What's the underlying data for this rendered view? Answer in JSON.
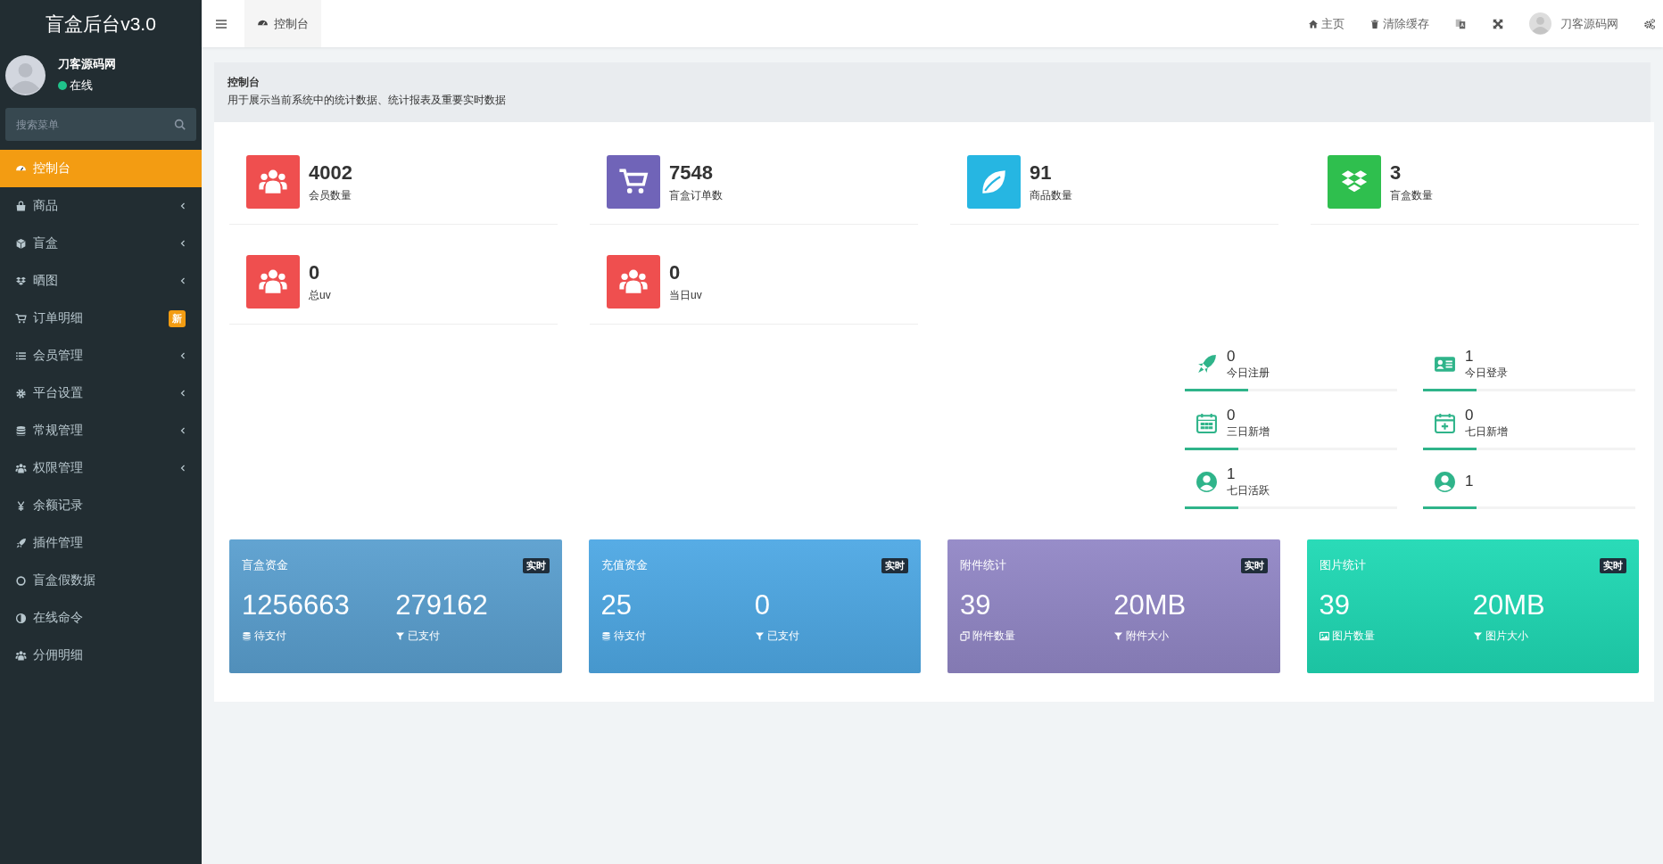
{
  "sidebar": {
    "logo": "盲盒后台v3.0",
    "user": {
      "name": "刀客源码网",
      "status": "在线",
      "online": true
    },
    "search": {
      "placeholder": "搜索菜单"
    },
    "items": [
      {
        "label": "控制台",
        "selected": true,
        "submenu": false
      },
      {
        "label": "商品",
        "selected": false,
        "submenu": true
      },
      {
        "label": "盲盒",
        "selected": false,
        "submenu": true
      },
      {
        "label": "晒图",
        "selected": false,
        "submenu": true
      },
      {
        "label": "订单明细",
        "selected": false,
        "submenu": false,
        "badge": "新"
      },
      {
        "label": "会员管理",
        "selected": false,
        "submenu": true
      },
      {
        "label": "平台设置",
        "selected": false,
        "submenu": true
      },
      {
        "label": "常规管理",
        "selected": false,
        "submenu": true
      },
      {
        "label": "权限管理",
        "selected": false,
        "submenu": true
      },
      {
        "label": "余额记录",
        "selected": false,
        "submenu": false
      },
      {
        "label": "插件管理",
        "selected": false,
        "submenu": false
      },
      {
        "label": "盲盒假数据",
        "selected": false,
        "submenu": false
      },
      {
        "label": "在线命令",
        "selected": false,
        "submenu": false
      },
      {
        "label": "分佣明细",
        "selected": false,
        "submenu": false
      }
    ]
  },
  "topbar": {
    "tabs": [
      {
        "label": "控制台"
      }
    ],
    "links": [
      {
        "label": "主页"
      },
      {
        "label": "清除缓存"
      }
    ],
    "user": "刀客源码网"
  },
  "page_header": {
    "title": "控制台",
    "description": "用于展示当前系统中的统计数据、统计报表及重要实时数据"
  },
  "stats": [
    {
      "value": "4002",
      "label": "会员数量",
      "color": "#ef4f4f"
    },
    {
      "value": "7548",
      "label": "盲盒订单数",
      "color": "#7064b8"
    },
    {
      "value": "91",
      "label": "商品数量",
      "color": "#26b6e2"
    },
    {
      "value": "3",
      "label": "盲盒数量",
      "color": "#2fbf4e"
    },
    {
      "value": "0",
      "label": "总uv",
      "color": "#ef4f4f"
    },
    {
      "value": "0",
      "label": "当日uv",
      "color": "#ef4f4f"
    }
  ],
  "mini_stats": [
    {
      "value": "0",
      "label": "今日注册",
      "level": 0.3
    },
    {
      "value": "1",
      "label": "今日登录",
      "level": 0.25
    },
    {
      "value": "0",
      "label": "三日新增",
      "level": 0.25
    },
    {
      "value": "0",
      "label": "七日新增",
      "level": 0.25
    },
    {
      "value": "1",
      "label": "七日活跃",
      "level": 0.25
    },
    {
      "value": "1",
      "level": 0.25
    }
  ],
  "cards": [
    {
      "title": "盲盒资金",
      "badge": "实时",
      "color": "#5a9fcf",
      "metrics": [
        {
          "value": "1256663",
          "label": "待支付"
        },
        {
          "value": "279162",
          "label": "已支付"
        }
      ]
    },
    {
      "title": "充值资金",
      "badge": "实时",
      "color": "#4ea8e4",
      "metrics": [
        {
          "value": "25",
          "label": "待支付"
        },
        {
          "value": "0",
          "label": "已支付"
        }
      ]
    },
    {
      "title": "附件统计",
      "badge": "实时",
      "color": "#9287c6",
      "metrics": [
        {
          "value": "39",
          "label": "附件数量"
        },
        {
          "value": "20MB",
          "label": "附件大小"
        }
      ]
    },
    {
      "title": "图片统计",
      "badge": "实时",
      "color": "#1fd9b4",
      "metrics": [
        {
          "value": "39",
          "label": "图片数量"
        },
        {
          "value": "20MB",
          "label": "图片大小"
        }
      ]
    }
  ]
}
